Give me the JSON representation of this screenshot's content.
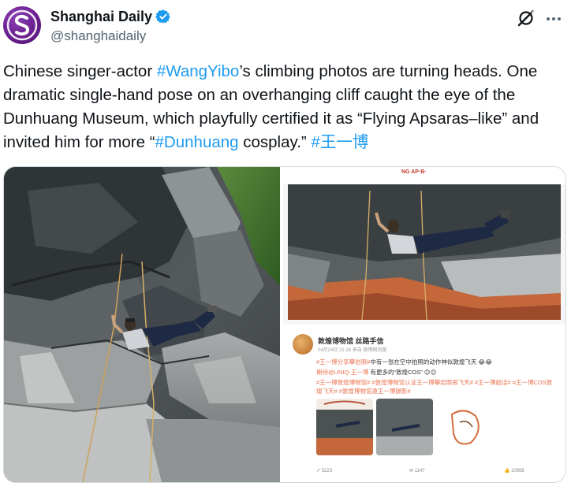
{
  "account": {
    "display_name": "Shanghai Daily",
    "handle": "@shanghaidaily",
    "avatar_icon": "shanghai-daily-logo",
    "verified_icon": "verified-badge-icon",
    "colors": {
      "verified": "#1d9bf0",
      "avatar": "#6a1f8f"
    }
  },
  "header_actions": {
    "grok_icon": "grok-icon",
    "more_icon": "more-options-icon"
  },
  "tweet": {
    "text_part1": "Chinese singer-actor ",
    "hashtag1": "#WangYibo",
    "text_part2": "’s climbing photos are turning heads. One dramatic single-hand pose on an overhanging cliff caught the eye of the Dunhuang Museum, which playfully certified it as “Flying Apsaras–like” and invited him for more “",
    "hashtag2": "#Dunhuang",
    "text_part3": " cosplay.” ",
    "hashtag3": "#王一博",
    "link_color": "#1d9bf0"
  },
  "media": {
    "photo_left": "climbing-photo",
    "photo_right": "weibo-screenshot",
    "weibo": {
      "account_name": "敦煌博物馆 丝路手信",
      "time": "04月24日 21:16  来自 微博网页版",
      "line1_tag": "#王一博分享攀岩照#",
      "line1_text": "中有一张在空中拍照的动作神似敦煌飞天 😂😂",
      "line2_tag": "期待@UNIQ-王一博",
      "line2_text": " 有更多的“敦煌COS” 😊😊",
      "line3": "#王一博敦煌博物馆# #敦煌博物馆认证王一博攀岩照很飞天# #王一博超话# #王一博COS敦煌飞天# #敦煌博物馆邀王一博摄影#",
      "footer_shares": "5223",
      "footer_comments": "1147",
      "footer_likes": "10656"
    }
  }
}
